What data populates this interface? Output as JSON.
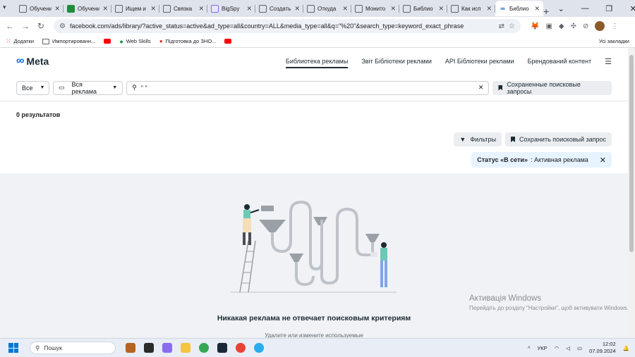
{
  "browser": {
    "tabs": [
      {
        "title": "Обучение",
        "favicon": "page-icon"
      },
      {
        "title": "Обучение",
        "favicon": "sheets-icon"
      },
      {
        "title": "Ищем и",
        "favicon": "page-icon"
      },
      {
        "title": "Связка",
        "favicon": "page-icon"
      },
      {
        "title": "BigSpy",
        "favicon": "bigspy-icon"
      },
      {
        "title": "Создать",
        "favicon": "page-icon"
      },
      {
        "title": "Откуда",
        "favicon": "page-icon"
      },
      {
        "title": "Монито",
        "favicon": "page-icon"
      },
      {
        "title": "Библио",
        "favicon": "page-icon"
      },
      {
        "title": "Как исп",
        "favicon": "page-icon"
      },
      {
        "title": "Библио",
        "favicon": "meta-icon",
        "active": true
      }
    ],
    "url": "facebook.com/ads/library/?active_status=active&ad_type=all&country=ALL&media_type=all&q=\"%20\"&search_type=keyword_exact_phrase",
    "bookmarks": [
      {
        "label": "Додатки",
        "icon": "apps-grid-icon"
      },
      {
        "label": "Импортированн...",
        "icon": "folder-icon"
      },
      {
        "label": "",
        "icon": "youtube-icon"
      },
      {
        "label": "Web Skills",
        "icon": "web-skills-icon"
      },
      {
        "label": "Підготовка до ЗНО...",
        "icon": "pin-icon"
      },
      {
        "label": "",
        "icon": "youtube-icon"
      }
    ],
    "all_bookmarks": "Усі закладки"
  },
  "page": {
    "logo": "Meta",
    "nav": [
      {
        "label": "Библиотека рекламы",
        "active": true
      },
      {
        "label": "Звіт Бібліотеки реклами"
      },
      {
        "label": "API Бібліотеки реклами"
      },
      {
        "label": "Брендований контент"
      }
    ],
    "filters": {
      "country": "Все",
      "ad_type": "Вся реклама",
      "search_value": "\" \"",
      "saved_searches": "Сохраненные поисковые запросы"
    },
    "results_count": "0 результатов",
    "filters_button": "Фильтры",
    "save_search_button": "Сохранить поисковый запрос",
    "status_chip": {
      "key": "Статус «В сети»",
      "value": ": Активная реклама"
    },
    "empty_title": "Никакая реклама не отвечает поисковым критериям",
    "empty_sub": "Удалите или измените используемые"
  },
  "activation": {
    "title": "Активація Windows",
    "text": "Перейдіть до розділу \"Настройки\", щоб активувати Windows."
  },
  "taskbar": {
    "search": "Пошук",
    "lang": "УКР",
    "time": "12:02",
    "date": "07.09.2024"
  }
}
